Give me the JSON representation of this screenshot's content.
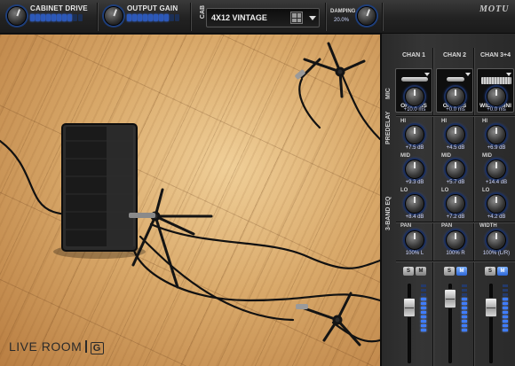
{
  "app": {
    "brand": "LIVE ROOM",
    "brand_badge": "G",
    "vendor_logo": "MOTU"
  },
  "toolbar": {
    "cabinet_drive": {
      "label": "CABINET DRIVE",
      "level": 0.55
    },
    "output_gain": {
      "label": "OUTPUT GAIN",
      "level": 0.55
    },
    "cab": {
      "label": "CAB",
      "value": "4X12 VINTAGE",
      "grid_icon": "grid-icon",
      "dropdown_icon": "chevron-down-icon"
    },
    "damping": {
      "label": "DAMPING",
      "value": "20.0%"
    }
  },
  "sections": {
    "mic": "MIC",
    "predelay": "PREDELAY",
    "eq": "3-BAND EQ"
  },
  "channels": [
    {
      "name": "CHAN 1",
      "mic": "OFF AXIS",
      "predelay": "+10.0 ms",
      "hi": "+7.5 dB",
      "mid": "+9.3 dB",
      "lo": "+8.4 dB",
      "pan_label": "PAN",
      "pan": "100% L",
      "solo": "S",
      "mute": "M",
      "mute_on": false
    },
    {
      "name": "CHAN 2",
      "mic": "ON AXIS",
      "predelay": "+0.0 ms",
      "hi": "+4.5 dB",
      "mid": "+5.7 dB",
      "lo": "+7.2 dB",
      "pan_label": "PAN",
      "pan": "100% R",
      "solo": "S",
      "mute": "M",
      "mute_on": true
    },
    {
      "name": "CHAN 3+4",
      "mic": "WIDE OMNI",
      "predelay": "+0.0 ms",
      "hi": "+6.9 dB",
      "mid": "+14.4 dB",
      "lo": "+4.2 dB",
      "pan_label": "WIDTH",
      "pan": "100% (L/R)",
      "solo": "S",
      "mute": "M",
      "mute_on": true
    }
  ],
  "eq_labels": {
    "hi": "HI",
    "mid": "MID",
    "lo": "LO"
  },
  "colors": {
    "accent": "#3f7dff",
    "panel": "#2e2e2e",
    "floor": "#d9a96a"
  }
}
